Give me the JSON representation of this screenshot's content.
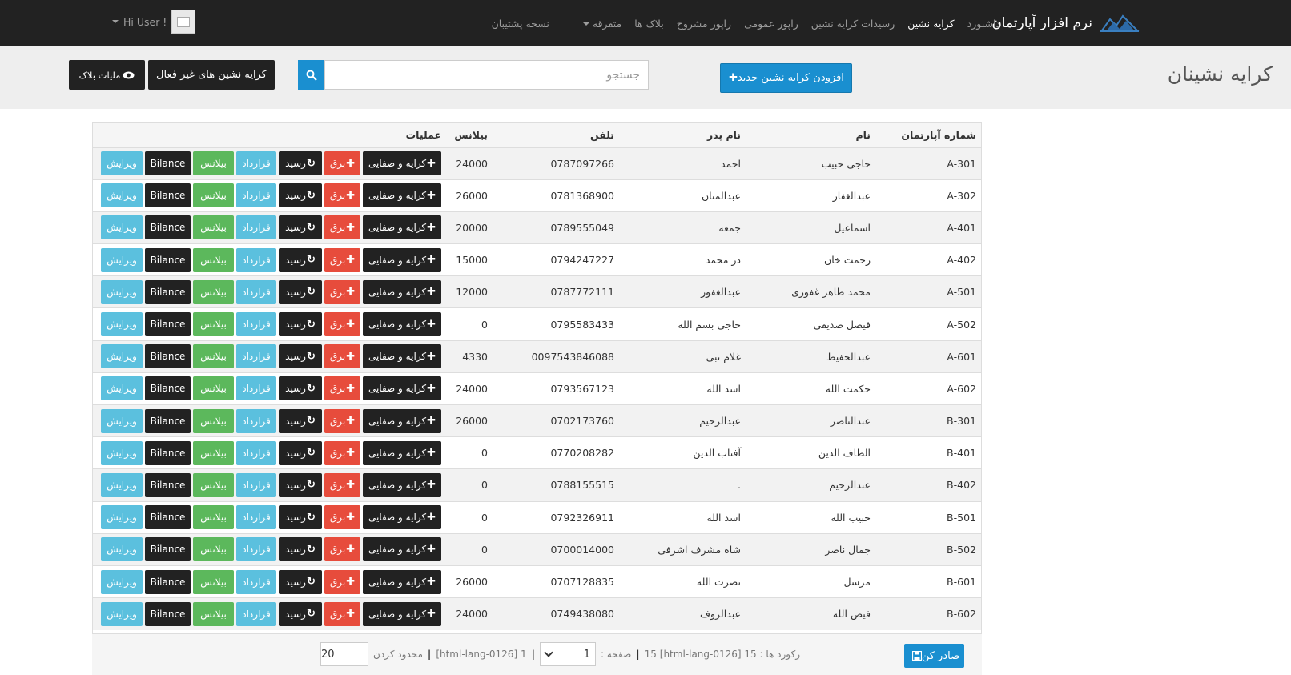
{
  "navbar": {
    "brand": "نرم افزار آپارتمان",
    "links": [
      {
        "label": "داشبورد",
        "active": false
      },
      {
        "label": "کرایه نشین",
        "active": true
      },
      {
        "label": "رسیدات کرایه نشین",
        "active": false
      },
      {
        "label": "راپور عمومی",
        "active": false
      },
      {
        "label": "راپور مشروح",
        "active": false
      },
      {
        "label": "بلاک ها",
        "active": false
      },
      {
        "label": "متفرقه",
        "active": false,
        "dropdown": true
      },
      {
        "label": "نسخه پشتیبان",
        "active": false
      }
    ],
    "user_label": "Hi User !"
  },
  "header": {
    "title": "کرایه نشینان",
    "add_button": "افزودن کرایه نشین جدید",
    "search_placeholder": "جستجو",
    "inactive_button": "کرایه نشین های غیر فعال",
    "block_button": "ملیات بلاک"
  },
  "table": {
    "columns": [
      "شماره آپارتمان",
      "نام",
      "نام پدر",
      "تلفن",
      "بیلانس",
      "عملیات"
    ],
    "actions": {
      "rent": "کرایه و صفایی",
      "electricity": "برق",
      "receipt": "رسید",
      "contract": "قرارداد",
      "balance": "بیلانس",
      "bilance": "Bilance",
      "edit": "ویرایش"
    },
    "rows": [
      {
        "apt": "A-301",
        "name": "حاجی حبیب",
        "father": "احمد",
        "phone": "0787097266",
        "balance": "24000"
      },
      {
        "apt": "A-302",
        "name": "عبدالغفار",
        "father": "عبدالمنان",
        "phone": "0781368900",
        "balance": "26000"
      },
      {
        "apt": "A-401",
        "name": "اسماعیل",
        "father": "جمعه",
        "phone": "0789555049",
        "balance": "20000"
      },
      {
        "apt": "A-402",
        "name": "رحمت خان",
        "father": "در محمد",
        "phone": "0794247227",
        "balance": "15000"
      },
      {
        "apt": "A-501",
        "name": "محمد ظاهر غفوری",
        "father": "عبدالغفور",
        "phone": "0787772111",
        "balance": "12000"
      },
      {
        "apt": "A-502",
        "name": "فیصل صدیقی",
        "father": "حاجی بسم الله",
        "phone": "0795583433",
        "balance": "0"
      },
      {
        "apt": "A-601",
        "name": "عبدالحفیظ",
        "father": "غلام نبی",
        "phone": "0097543846088",
        "balance": "4330"
      },
      {
        "apt": "A-602",
        "name": "حکمت الله",
        "father": "اسد الله",
        "phone": "0793567123",
        "balance": "24000"
      },
      {
        "apt": "B-301",
        "name": "عبدالناصر",
        "father": "عبدالرحیم",
        "phone": "0702173760",
        "balance": "26000"
      },
      {
        "apt": "B-401",
        "name": "الطاف الدین",
        "father": "آفتاب الدین",
        "phone": "0770208282",
        "balance": "0"
      },
      {
        "apt": "B-402",
        "name": "عبدالرحیم",
        "father": ".",
        "phone": "0788155515",
        "balance": "0"
      },
      {
        "apt": "B-501",
        "name": "حبیب الله",
        "father": "اسد الله",
        "phone": "0792326911",
        "balance": "0"
      },
      {
        "apt": "B-502",
        "name": "جمال ناصر",
        "father": "شاه مشرف اشرفی",
        "phone": "0700014000",
        "balance": "0"
      },
      {
        "apt": "B-601",
        "name": "مرسل",
        "father": "نصرت الله",
        "phone": "0707128835",
        "balance": "26000"
      },
      {
        "apt": "B-602",
        "name": "فیض الله",
        "father": "عبدالروف",
        "phone": "0749438080",
        "balance": "24000"
      }
    ]
  },
  "footer": {
    "export_button": "صادر کن",
    "records_text": "رکورد ها : 15 [html-lang-0126] 15",
    "page_label": "صفحه :",
    "page_value": "1",
    "pages_text": "1 [html-lang-0126]",
    "limit_label": "محدود کردن",
    "limit_value": "20"
  }
}
